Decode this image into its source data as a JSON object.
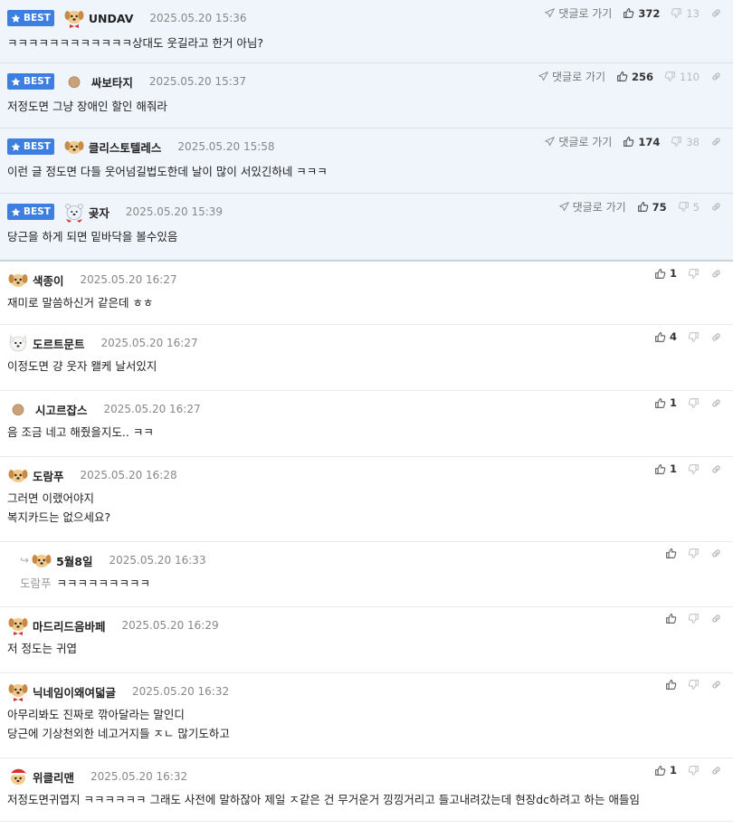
{
  "badge_label": "BEST",
  "goto_label": "댓글로 가기",
  "best": [
    {
      "nick": "UNDAV",
      "avatar": "puppy-bowtie",
      "date": "2025.05.20 15:36",
      "up": "372",
      "down": "13",
      "text": "ㅋㅋㅋㅋㅋㅋㅋㅋㅋㅋㅋㅋ상대도 웃길라고 한거 아님?"
    },
    {
      "nick": "싸보타지",
      "avatar": "dot",
      "date": "2025.05.20 15:37",
      "up": "256",
      "down": "110",
      "text": "저정도면 그냥 장애인 할인 해줘라"
    },
    {
      "nick": "클리스토텔레스",
      "avatar": "puppy",
      "date": "2025.05.20 15:58",
      "up": "174",
      "down": "38",
      "text": "이런 글 정도면 다들 웃어넘길법도한데 날이 많이 서있긴하네 ㅋㅋㅋ"
    },
    {
      "nick": "곶자",
      "avatar": "bear",
      "date": "2025.05.20 15:39",
      "up": "75",
      "down": "5",
      "text": "당근을 하게 되면 밑바닥을 볼수있음"
    }
  ],
  "comments": [
    {
      "nick": "색종이",
      "avatar": "puppy",
      "date": "2025.05.20 16:27",
      "up": "1",
      "lines": [
        "재미로 말씀하신거 같은데 ㅎㅎ"
      ]
    },
    {
      "nick": "도르트문트",
      "avatar": "white-dog",
      "date": "2025.05.20 16:27",
      "up": "4",
      "lines": [
        "이정도면 걍 웃자 왤케 날서있지"
      ]
    },
    {
      "nick": "시고르잡스",
      "avatar": "dot",
      "date": "2025.05.20 16:27",
      "up": "1",
      "lines": [
        "음 조금 네고 해줬을지도.. ㅋㅋ"
      ]
    },
    {
      "nick": "도람푸",
      "avatar": "puppy",
      "date": "2025.05.20 16:28",
      "up": "1",
      "lines": [
        "그러면 이랬어야지",
        "복지카드는 없으세요?"
      ]
    },
    {
      "nick": "5월8일",
      "avatar": "puppy",
      "date": "2025.05.20 16:33",
      "up": "",
      "reply": true,
      "mention": "도람푸",
      "lines": [
        "ㅋㅋㅋㅋㅋㅋㅋㅋㅋ"
      ]
    },
    {
      "nick": "마드리드음바페",
      "avatar": "puppy-bowtie",
      "date": "2025.05.20 16:29",
      "up": "",
      "lines": [
        "저 정도는 귀엽"
      ]
    },
    {
      "nick": "닉네임이왜여덟글",
      "avatar": "puppy-bowtie",
      "date": "2025.05.20 16:32",
      "up": "",
      "lines": [
        "아무리봐도 진짜로 깎아달라는 말인디",
        "당근에 기상천외한 네고거지들 ㅈㄴ 많기도하고"
      ]
    },
    {
      "nick": "위클리맨",
      "avatar": "santa-dog",
      "date": "2025.05.20 16:32",
      "up": "1",
      "lines": [
        "저정도면귀엽지 ㅋㅋㅋㅋㅋㅋ 그래도 사전에 말하잖아 제일 ㅈ같은 건 무거운거 낑낑거리고 들고내려갔는데 현장dc하려고 하는 애들임"
      ]
    }
  ]
}
